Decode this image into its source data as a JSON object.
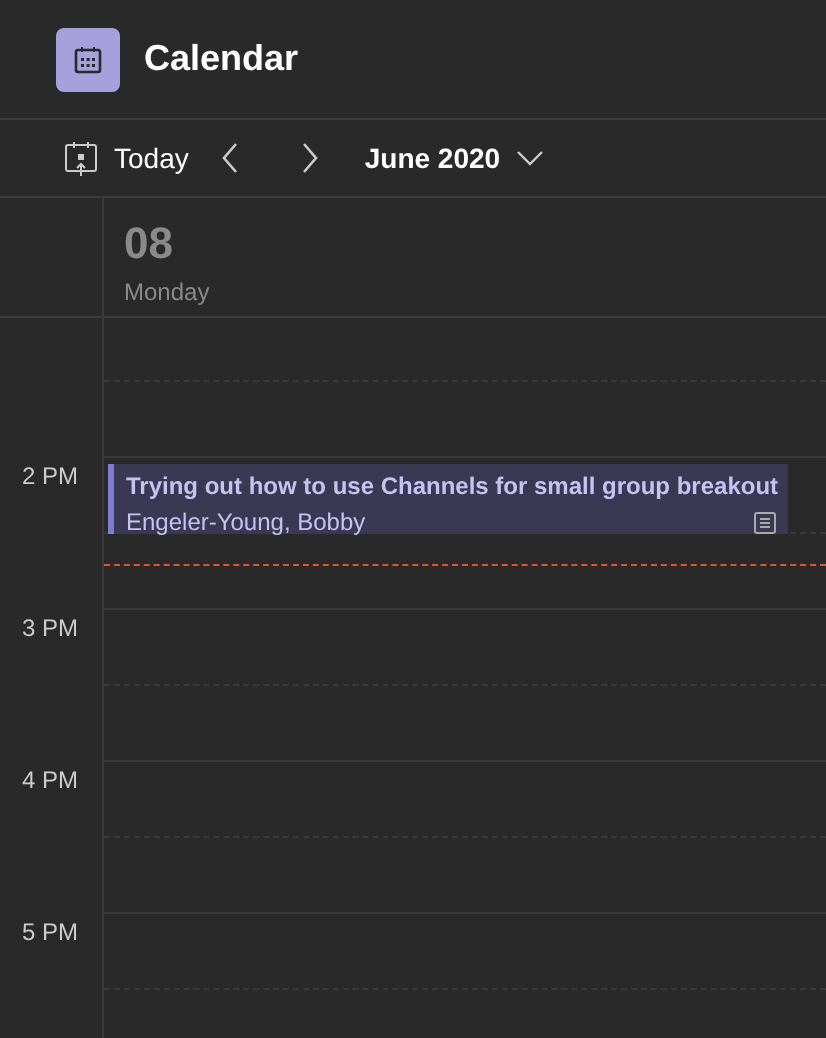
{
  "app": {
    "title": "Calendar"
  },
  "toolbar": {
    "today": "Today",
    "month": "June 2020"
  },
  "day": {
    "date": "08",
    "weekday": "Monday"
  },
  "hours": [
    {
      "label": "2 PM"
    },
    {
      "label": "3 PM"
    },
    {
      "label": "4 PM"
    },
    {
      "label": "5 PM"
    }
  ],
  "events": [
    {
      "title": "Trying out how to use Channels for small group breakout",
      "organizer": "Engeler-Young, Bobby",
      "has_notes": true
    }
  ]
}
